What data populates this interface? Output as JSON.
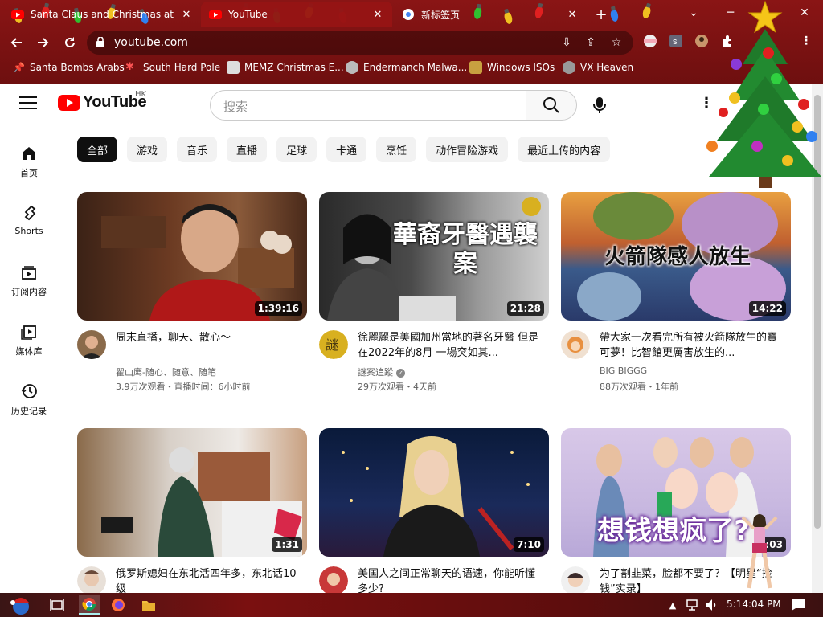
{
  "browser": {
    "tabs": [
      {
        "title": "Santa Claus and Christmas at the",
        "close": "✕",
        "active": false
      },
      {
        "title": "YouTube",
        "close": "✕",
        "active": true
      },
      {
        "title": "新标签页",
        "close": "✕",
        "active": false
      }
    ],
    "new_tab": "+",
    "url": "youtube.com",
    "bookmarks": [
      {
        "label": "Santa Bombs Arabs"
      },
      {
        "label": "South Hard Pole"
      },
      {
        "label": "MEMZ Christmas E..."
      },
      {
        "label": "Endermanch Malwa..."
      },
      {
        "label": "Windows ISOs"
      },
      {
        "label": "VX Heaven"
      }
    ],
    "window": {
      "minimize": "─",
      "close": "✕",
      "tabs_menu": "⌄"
    }
  },
  "youtube": {
    "logo": "YouTube",
    "region": "HK",
    "search_placeholder": "搜索",
    "chips": [
      "全部",
      "游戏",
      "音乐",
      "直播",
      "足球",
      "卡通",
      "烹饪",
      "动作冒险游戏",
      "最近上传的内容"
    ],
    "guide": [
      {
        "label": "首页",
        "icon": "home-icon"
      },
      {
        "label": "Shorts",
        "icon": "shorts-icon"
      },
      {
        "label": "订阅内容",
        "icon": "subscriptions-icon"
      },
      {
        "label": "媒体库",
        "icon": "library-icon"
      },
      {
        "label": "历史记录",
        "icon": "history-icon"
      }
    ],
    "videos": [
      {
        "title": "周末直播，聊天、散心～",
        "channel": "翟山鹰-随心、随意、随笔",
        "stats": "3.9万次观看・直播时间：6小时前",
        "duration": "1:39:16",
        "verified": false
      },
      {
        "title": "徐麗麗是美國加州當地的著名牙醫 但是在2022年的8月 一場突如其...",
        "channel": "謎案追蹤",
        "stats": "29万次观看・4天前",
        "duration": "21:28",
        "verified": true,
        "overlay": "華裔牙醫遇襲案"
      },
      {
        "title": "帶大家一次看完所有被火箭隊放生的寶可夢！比智館更厲害放生的...",
        "channel": "BIG BIGGG",
        "stats": "88万次观看・1年前",
        "duration": "14:22",
        "verified": false,
        "overlay": "火箭隊感人放生"
      },
      {
        "title": "俄罗斯媳妇在东北活四年多，东北话10级",
        "channel": "",
        "stats": "",
        "duration": "1:31",
        "verified": false
      },
      {
        "title": "美国人之间正常聊天的语速，你能听懂多少?",
        "channel": "",
        "stats": "",
        "duration": "7:10",
        "verified": false
      },
      {
        "title": "为了割韭菜，脸都不要了？【明星“捡钱”实录】",
        "channel": "",
        "stats": "",
        "duration": "1:03",
        "verified": false,
        "overlay": "想钱想疯了?"
      }
    ]
  },
  "taskbar": {
    "time": "5:14:04 PM"
  },
  "colors": {
    "chrome_red": "#8a1515",
    "yt_red": "#ff0000",
    "chip_active": "#0f0f0f"
  }
}
